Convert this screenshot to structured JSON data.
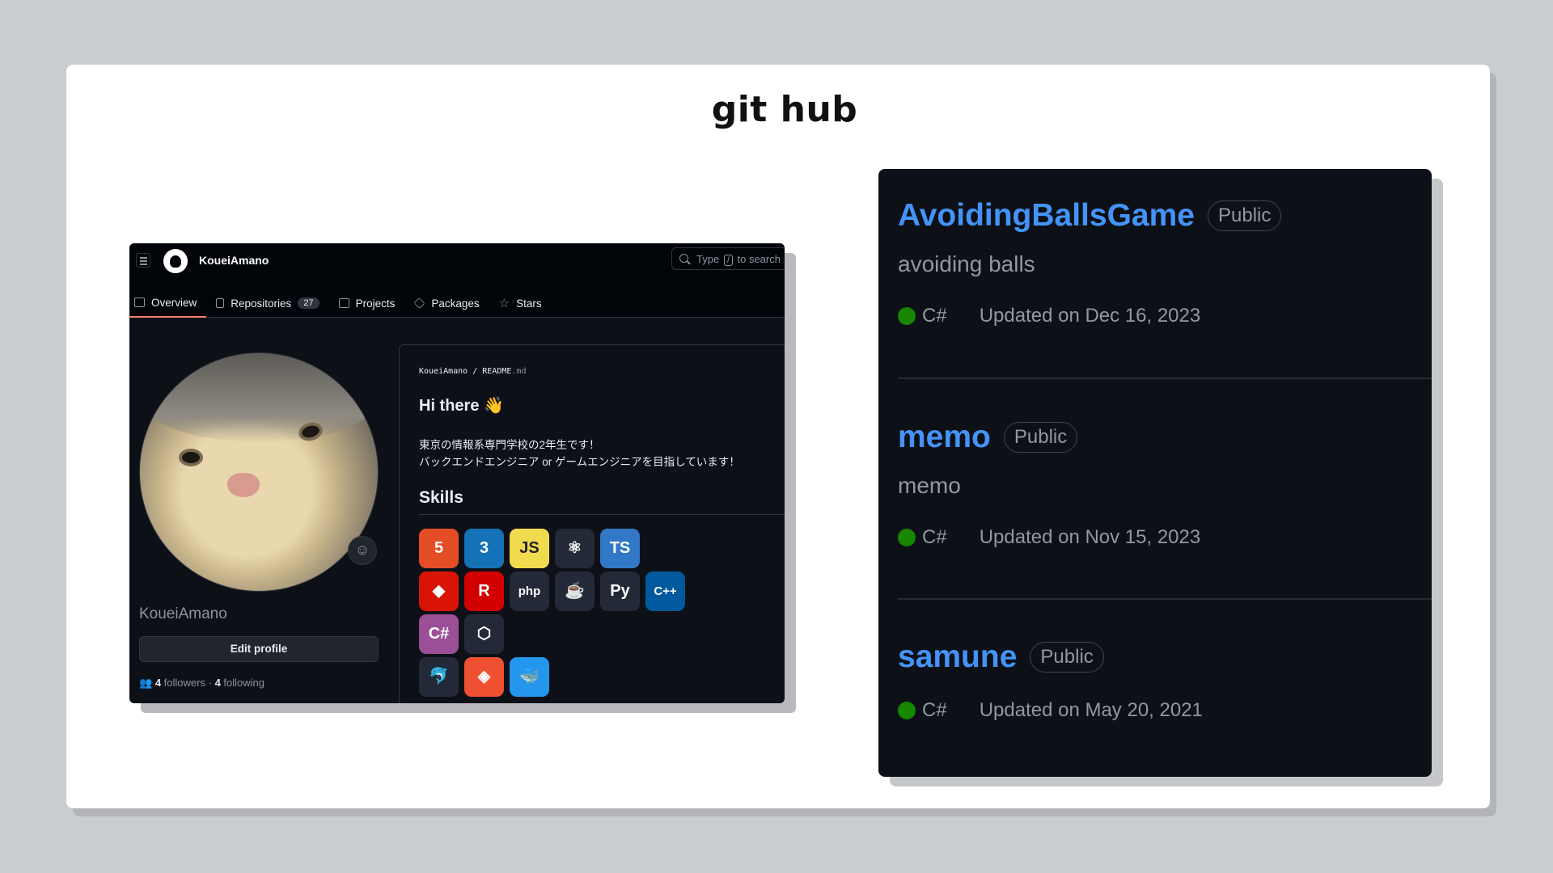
{
  "slide": {
    "title": "git hub"
  },
  "profile": {
    "username": "KoueiAmano",
    "search": {
      "prefix": "Type",
      "key": "/",
      "suffix": "to search"
    },
    "tabs": [
      {
        "label": "Overview"
      },
      {
        "label": "Repositories",
        "count": "27"
      },
      {
        "label": "Projects"
      },
      {
        "label": "Packages"
      },
      {
        "label": "Stars"
      }
    ],
    "display_name": "KoueiAmano",
    "edit_button": "Edit profile",
    "followers_count": "4",
    "followers_label": "followers",
    "separator": "·",
    "following_count": "4",
    "following_label": "following",
    "readme": {
      "path_user": "KoueiAmano",
      "path_sep": " / ",
      "path_file": "README",
      "path_ext": ".md",
      "greeting": "Hi there",
      "wave": "👋",
      "line1": "東京の情報系専門学校の2年生です！",
      "line2": "バックエンドエンジニア or ゲームエンジニアを目指しています！",
      "skills_heading": "Skills",
      "skills": [
        {
          "name": "html5-icon",
          "glyph": "5",
          "color": "#e44d26"
        },
        {
          "name": "css3-icon",
          "glyph": "3",
          "color": "#1572b6"
        },
        {
          "name": "javascript-icon",
          "glyph": "JS",
          "color": "#f0db4f"
        },
        {
          "name": "react-icon",
          "glyph": "⚛",
          "color": "#242938"
        },
        {
          "name": "typescript-icon",
          "glyph": "TS",
          "color": "#3178c6"
        },
        {
          "name": "ruby-icon",
          "glyph": "◆",
          "color": "#d91404"
        },
        {
          "name": "rails-icon",
          "glyph": "R",
          "color": "#d30001"
        },
        {
          "name": "php-icon",
          "glyph": "php",
          "color": "#242938"
        },
        {
          "name": "java-icon",
          "glyph": "☕",
          "color": "#242938"
        },
        {
          "name": "python-icon",
          "glyph": "Py",
          "color": "#242938"
        },
        {
          "name": "cpp-icon",
          "glyph": "C++",
          "color": "#00599c"
        },
        {
          "name": "csharp-icon",
          "glyph": "C#",
          "color": "#9b4f96"
        },
        {
          "name": "unity-icon",
          "glyph": "⬡",
          "color": "#242938"
        },
        {
          "name": "mysql-icon",
          "glyph": "🐬",
          "color": "#242938"
        },
        {
          "name": "git-icon",
          "glyph": "◈",
          "color": "#f05032"
        },
        {
          "name": "docker-icon",
          "glyph": "🐳",
          "color": "#2496ed"
        }
      ]
    }
  },
  "repos": [
    {
      "name": "AvoidingBallsGame",
      "visibility": "Public",
      "description": "avoiding balls",
      "language": "C#",
      "lang_color": "#178600",
      "updated": "Updated on Dec 16, 2023"
    },
    {
      "name": "memo",
      "visibility": "Public",
      "description": "memo",
      "language": "C#",
      "lang_color": "#178600",
      "updated": "Updated on Nov 15, 2023"
    },
    {
      "name": "samune",
      "visibility": "Public",
      "description": "",
      "language": "C#",
      "lang_color": "#178600",
      "updated": "Updated on May 20, 2021"
    }
  ]
}
